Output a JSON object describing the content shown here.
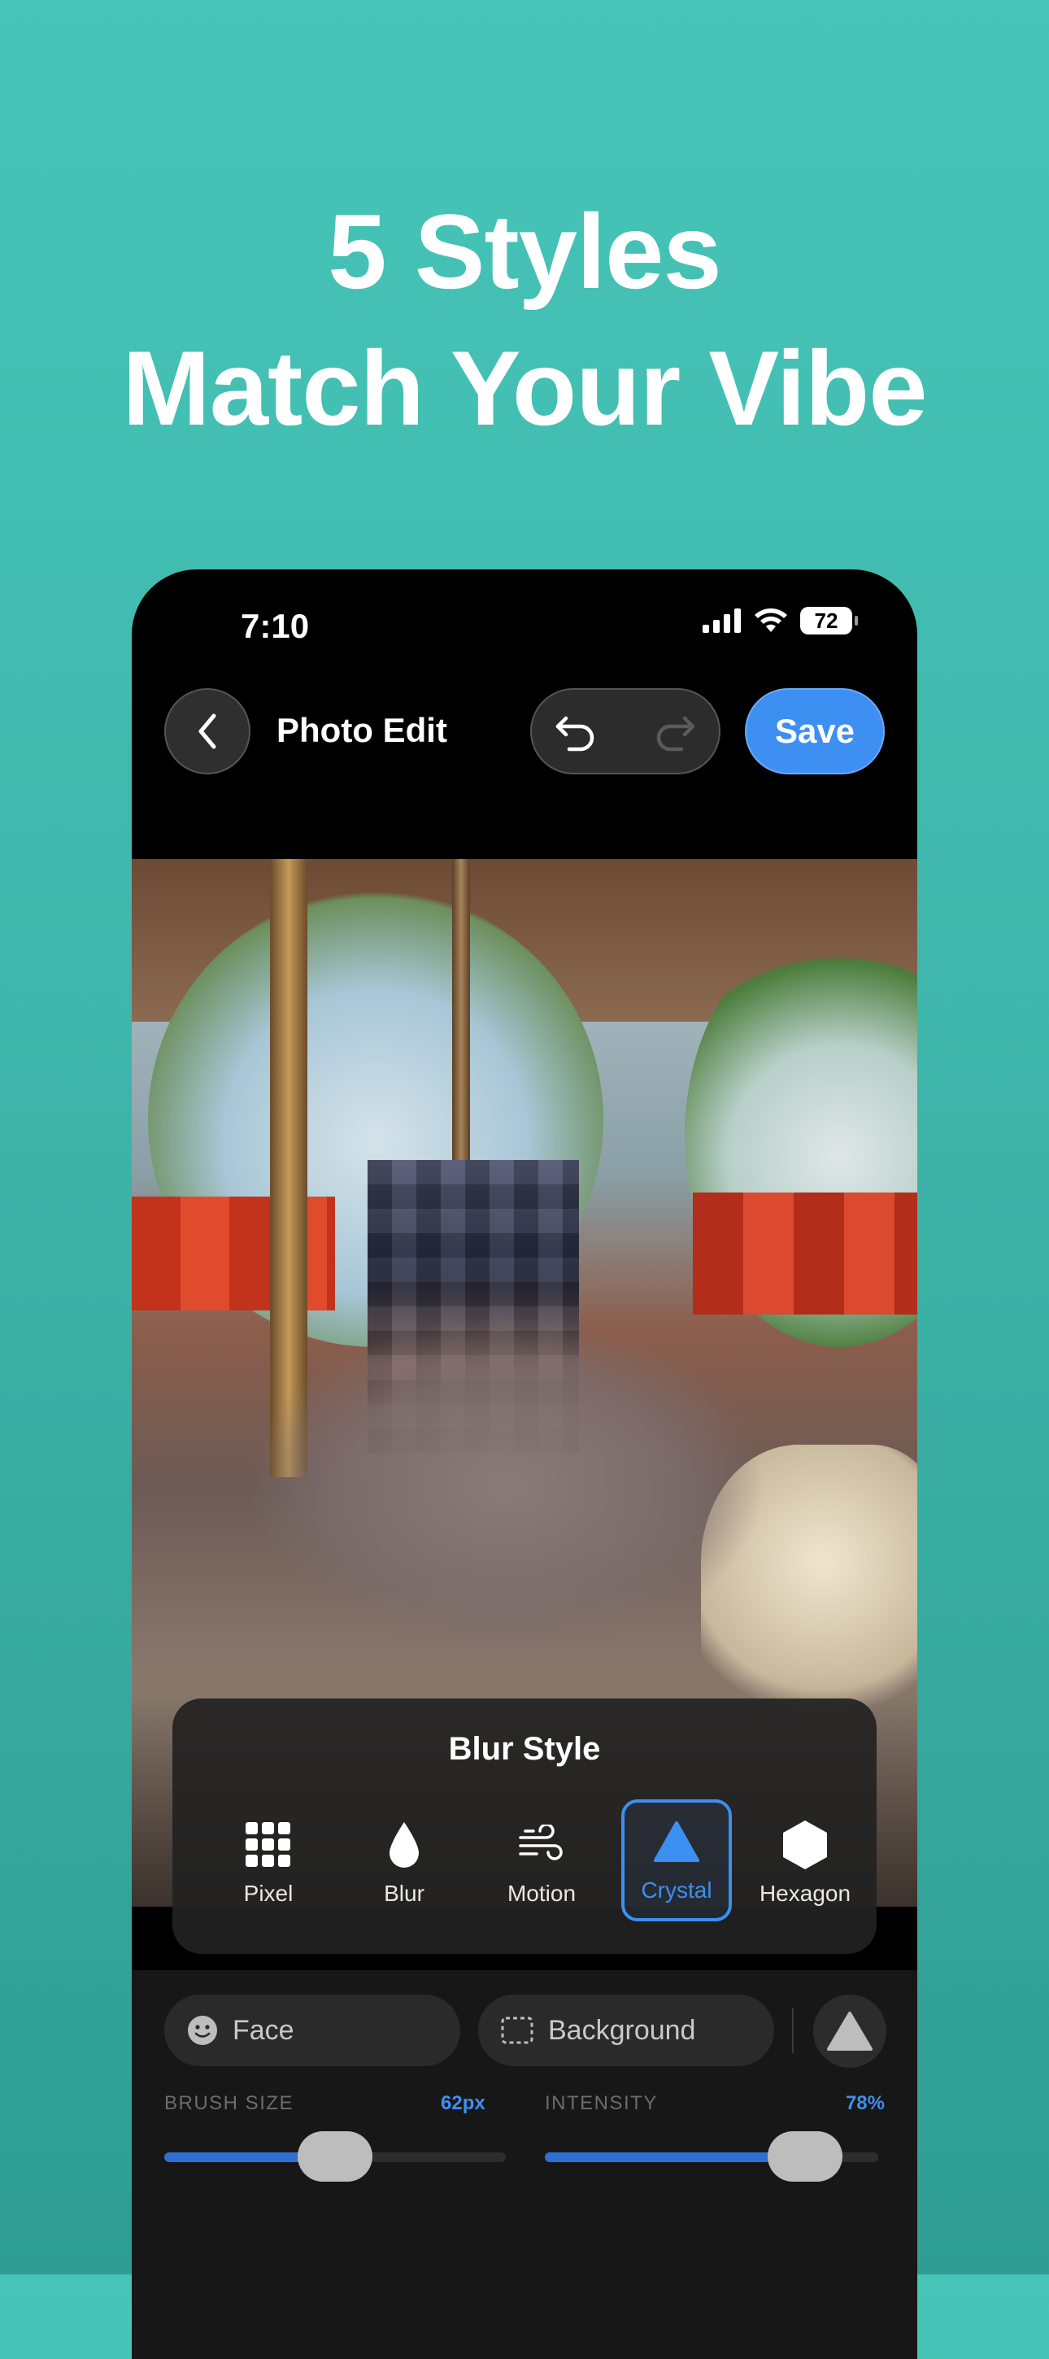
{
  "headline": {
    "line1": "5 Styles",
    "line2": "Match Your Vibe"
  },
  "status_bar": {
    "time": "7:10",
    "battery": "72"
  },
  "nav": {
    "title": "Photo Edit",
    "save_label": "Save"
  },
  "style_panel": {
    "title": "Blur Style",
    "options": [
      {
        "label": "Pixel",
        "icon": "grid-icon"
      },
      {
        "label": "Blur",
        "icon": "drop-icon"
      },
      {
        "label": "Motion",
        "icon": "wind-icon"
      },
      {
        "label": "Crystal",
        "icon": "triangle-icon",
        "selected": true
      },
      {
        "label": "Hexagon",
        "icon": "hexagon-icon"
      }
    ]
  },
  "tools": {
    "face_label": "Face",
    "background_label": "Background"
  },
  "sliders": {
    "brush": {
      "label": "BRUSH SIZE",
      "value_text": "62px",
      "fill_fraction": 0.5
    },
    "intensity": {
      "label": "INTENSITY",
      "value_text": "78%",
      "fill_fraction": 0.78
    }
  },
  "colors": {
    "accent": "#3d8ff2",
    "background_top": "#46c5b8",
    "background_bottom": "#2f9d93"
  }
}
